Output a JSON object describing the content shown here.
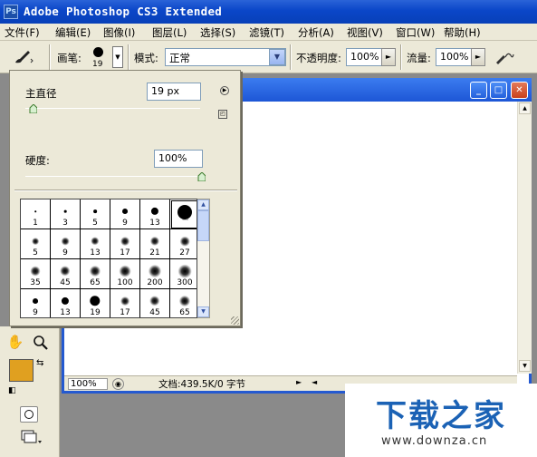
{
  "titlebar": {
    "app_icon": "Ps",
    "title": "Adobe Photoshop CS3 Extended"
  },
  "menu": [
    "文件(F)",
    "编辑(E)",
    "图像(I)",
    "图层(L)",
    "选择(S)",
    "滤镜(T)",
    "分析(A)",
    "视图(V)",
    "窗口(W)",
    "帮助(H)"
  ],
  "options": {
    "brush_label": "画笔:",
    "brush_size": "19",
    "mode_label": "模式:",
    "mode_value": "正常",
    "opacity_label": "不透明度:",
    "opacity_value": "100%",
    "flow_label": "流量:",
    "flow_value": "100%"
  },
  "brush_panel": {
    "diameter_label": "主直径",
    "diameter_value": "19 px",
    "diameter_level": 0.04,
    "hardness_label": "硬度:",
    "hardness_value": "100%",
    "hardness_level": 1.0,
    "presets": [
      {
        "size": "1",
        "type": "hard"
      },
      {
        "size": "3",
        "type": "hard"
      },
      {
        "size": "5",
        "type": "hard"
      },
      {
        "size": "9",
        "type": "hard"
      },
      {
        "size": "13",
        "type": "hard"
      },
      {
        "size": "",
        "type": "hard",
        "selected": true
      },
      {
        "size": "5",
        "type": "soft"
      },
      {
        "size": "9",
        "type": "soft"
      },
      {
        "size": "13",
        "type": "soft"
      },
      {
        "size": "17",
        "type": "soft"
      },
      {
        "size": "21",
        "type": "soft"
      },
      {
        "size": "27",
        "type": "soft"
      },
      {
        "size": "35",
        "type": "soft"
      },
      {
        "size": "45",
        "type": "soft"
      },
      {
        "size": "65",
        "type": "soft"
      },
      {
        "size": "100",
        "type": "soft"
      },
      {
        "size": "200",
        "type": "soft"
      },
      {
        "size": "300",
        "type": "soft"
      },
      {
        "size": "9",
        "type": "hard"
      },
      {
        "size": "13",
        "type": "hard"
      },
      {
        "size": "19",
        "type": "hard"
      },
      {
        "size": "17",
        "type": "soft"
      },
      {
        "size": "45",
        "type": "soft"
      },
      {
        "size": "65",
        "type": "soft"
      }
    ]
  },
  "document": {
    "zoom": "100%",
    "status": "文档:439.5K/0 字节"
  },
  "toolbox": {
    "foreground_color": "#e0a020",
    "background_color": "#ffffff"
  },
  "watermark": {
    "title": "下载之家",
    "url": "www.downza.cn"
  }
}
